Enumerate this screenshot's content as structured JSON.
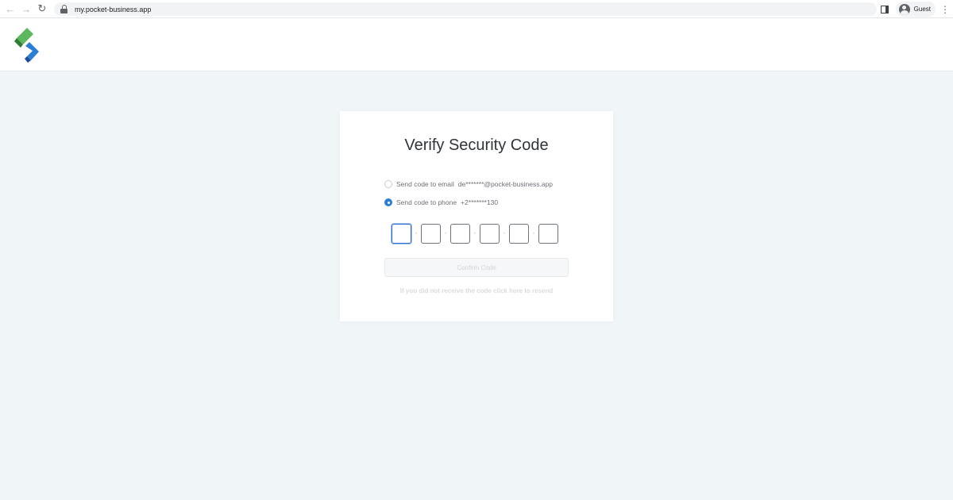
{
  "browser": {
    "url": "my.pocket-business.app",
    "profile_label": "Guest"
  },
  "card": {
    "title": "Verify Security Code",
    "options": [
      {
        "label": "Send code to email",
        "value": "de*******@pocket-business.app",
        "selected": false
      },
      {
        "label": "Send code to phone",
        "value": "+2*******130",
        "selected": true
      }
    ],
    "code_separator": "-",
    "confirm_label": "Confirm Code",
    "resend_text": "If you did not receive the code click here to resend"
  },
  "colors": {
    "page_background": "#f0f5f8",
    "accent": "#2d7fd6",
    "logo_green": "#5cb85c",
    "logo_blue": "#2a7fd4"
  }
}
